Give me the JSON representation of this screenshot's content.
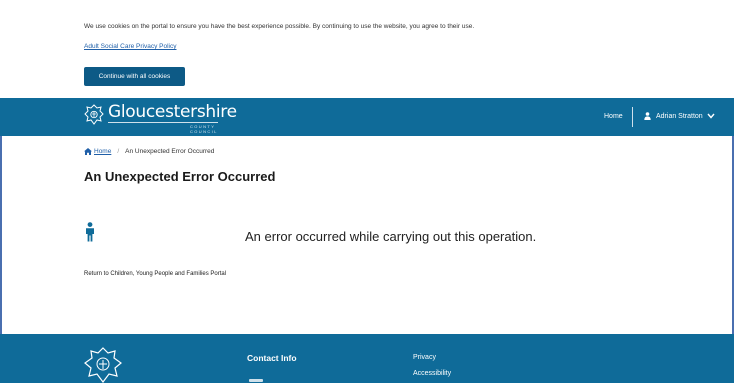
{
  "cookie_banner": {
    "message": "We use cookies on the portal to ensure you have the best experience possible. By continuing to use the website, you agree to their use.",
    "privacy_link": "Adult Social Care Privacy Policy",
    "accept_button": "Continue with all cookies"
  },
  "header": {
    "logo_text": "Gloucestershire",
    "logo_subtext": "COUNTY COUNCIL",
    "nav_home": "Home",
    "user_name": "Adrian Stratton"
  },
  "breadcrumb": {
    "home": "Home",
    "current": "An Unexpected Error Occurred"
  },
  "page": {
    "title": "An Unexpected Error Occurred",
    "error_message": "An error occurred while carrying out this operation.",
    "return_link": "Return to Children, Young People and Families Portal"
  },
  "footer": {
    "contact_heading": "Contact Info",
    "links": [
      "Privacy",
      "Accessibility"
    ]
  },
  "colors": {
    "brand_blue": "#0f6b99",
    "button_blue": "#0d5a86",
    "link_blue": "#1f5fa8"
  }
}
